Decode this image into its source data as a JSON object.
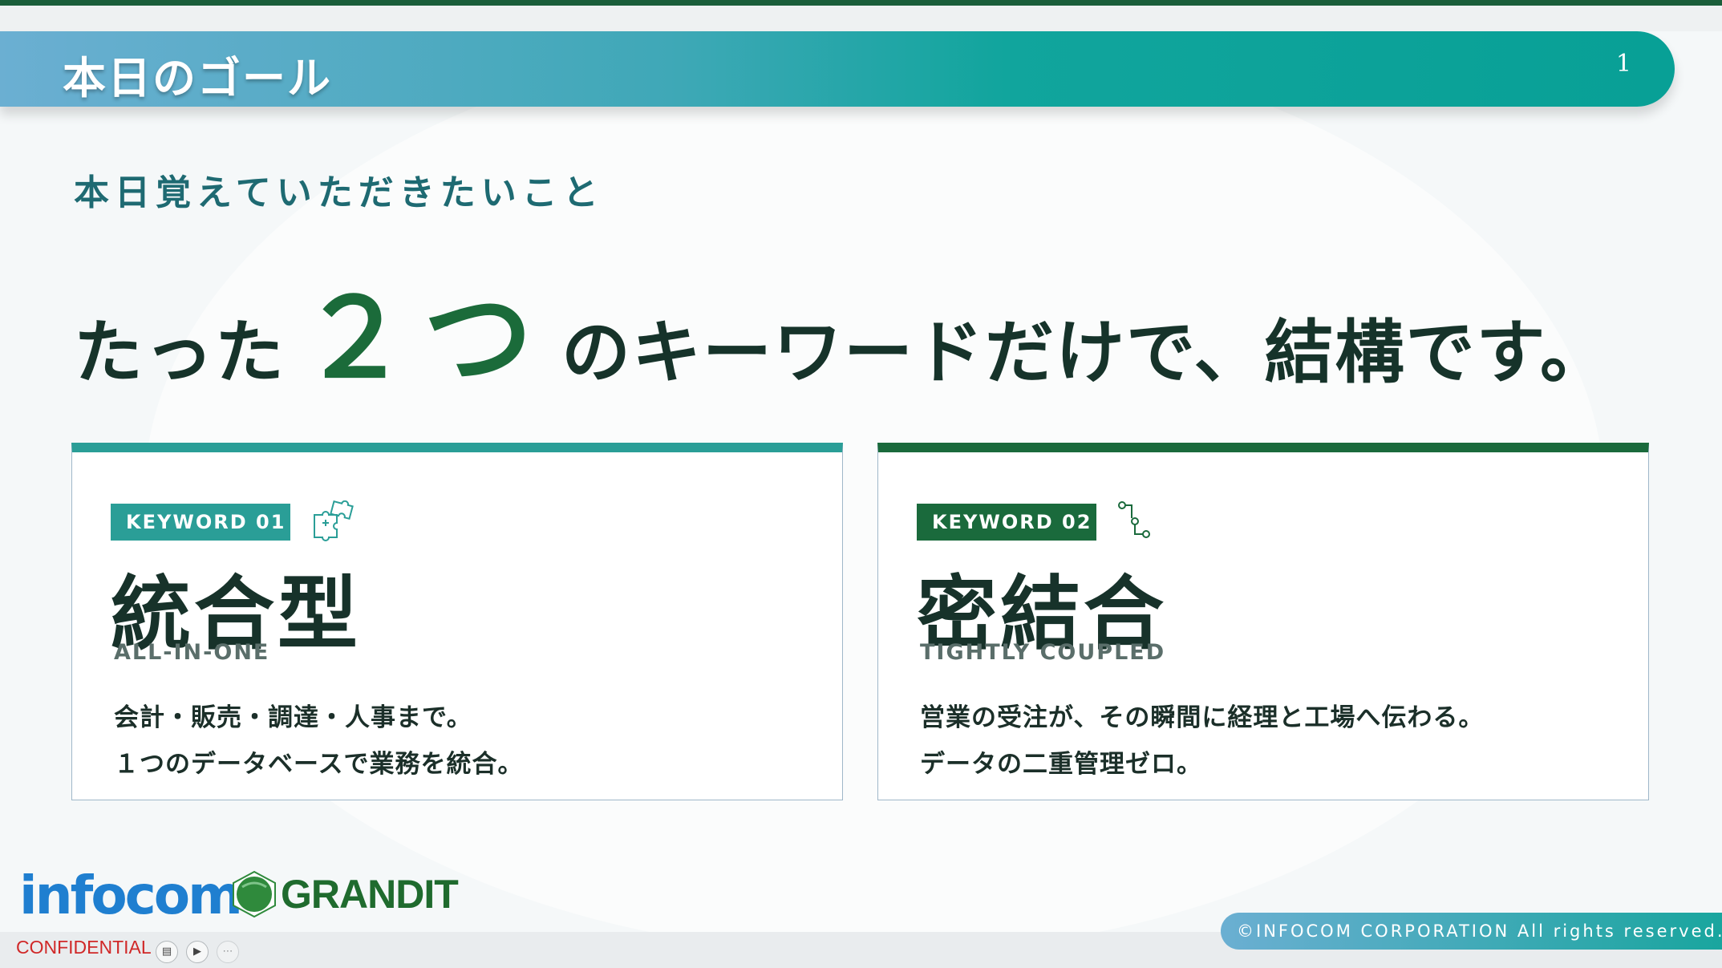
{
  "header": {
    "title": "本日のゴール",
    "page_number": "1"
  },
  "subtitle": "本日覚えていただきたいこと",
  "headline": {
    "before": "たった",
    "number": "２つ",
    "after": "のキーワードだけで、結構です。"
  },
  "keywords": [
    {
      "badge": "KEYWORD 01",
      "icon": "puzzle-icon",
      "title": "統合型",
      "english": "ALL-IN-ONE",
      "lines": [
        "会計・販売・調達・人事まで。",
        "１つのデータベースで業務を統合。"
      ]
    },
    {
      "badge": "KEYWORD 02",
      "icon": "flow-connection-icon",
      "title": "密結合",
      "english": "TIGHTLY COUPLED",
      "lines": [
        "営業の受注が、その瞬間に経理と工場へ伝わる。",
        "データの二重管理ゼロ。"
      ]
    }
  ],
  "footer": {
    "logo_infocom": "infocom",
    "logo_grandit": "GRANDIT",
    "copyright": "©INFOCOM CORPORATION All rights reserved.",
    "confidential": "CONFIDENTIAL"
  },
  "colors": {
    "teal": "#2a9e97",
    "dark_green": "#1a6a3c",
    "heading_teal": "#1e6a72",
    "confidential_red": "#d02828"
  }
}
